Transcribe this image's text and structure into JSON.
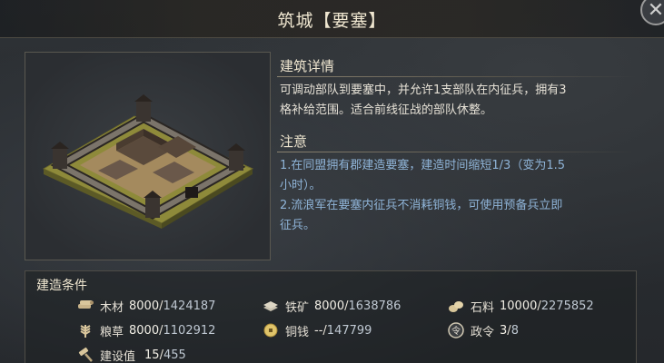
{
  "window": {
    "title": "筑城【要塞】",
    "close_icon": "close-icon"
  },
  "detail": {
    "heading": "建筑详情",
    "line1": "可调动部队到要塞中，并允许1支部队在内征兵，拥有3",
    "line2": "格补给范围。适合前线征战的部队休整。"
  },
  "notice": {
    "heading": "注意",
    "line1": "1.在同盟拥有郡建造要塞，建造时间缩短1/3（变为1.5",
    "line2": "小时）。",
    "line3": "2.流浪军在要塞内征兵不消耗铜钱，可使用预备兵立即",
    "line4": "征兵。"
  },
  "conditions": {
    "heading": "建造条件",
    "items": [
      {
        "label": "木材",
        "need": "8000",
        "have": "1424187",
        "icon": "wood-icon"
      },
      {
        "label": "铁矿",
        "need": "8000",
        "have": "1638786",
        "icon": "iron-icon"
      },
      {
        "label": "石料",
        "need": "10000",
        "have": "2275852",
        "icon": "stone-icon"
      },
      {
        "label": "粮草",
        "need": "8000",
        "have": "1102912",
        "icon": "grain-icon"
      },
      {
        "label": "铜钱",
        "need": "--",
        "have": "147799",
        "icon": "coin-icon"
      },
      {
        "label": "政令",
        "need": "3",
        "have": "8",
        "icon": "decree-icon"
      },
      {
        "label": "建设值",
        "need": "15",
        "have": "455",
        "icon": "hammer-icon"
      }
    ]
  },
  "colors": {
    "accent_text": "#efe6d0",
    "blue_text": "#8fb4d8",
    "panel_border": "#5a5850"
  }
}
